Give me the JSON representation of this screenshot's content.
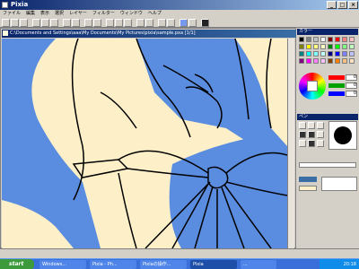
{
  "window": {
    "title": "Pixia",
    "minimize": "_",
    "maximize": "□",
    "close": "×"
  },
  "menu": [
    "ファイル",
    "編集",
    "表示",
    "選択",
    "レイヤー",
    "フィルター",
    "ウィンドウ",
    "ヘルプ"
  ],
  "document": {
    "title": "C:\\Documents and Settings\\aaa\\My Documents\\My Pictures\\pixia\\sample.pxa [1/1]"
  },
  "colors": {
    "canvas_bg": "#5a8de0",
    "skin": "#fdf0c8",
    "line": "#000000",
    "accent": "#0a246a"
  },
  "palette": {
    "title": "カラー",
    "swatches": [
      "#000000",
      "#808080",
      "#c0c0c0",
      "#ffffff",
      "#800000",
      "#ff0000",
      "#ff8080",
      "#ffc0c0",
      "#808000",
      "#ffff00",
      "#ffff80",
      "#ffffc0",
      "#008000",
      "#00ff00",
      "#80ff80",
      "#c0ffc0",
      "#008080",
      "#00ffff",
      "#80ffff",
      "#c0ffff",
      "#000080",
      "#0000ff",
      "#8080ff",
      "#c0c0ff",
      "#800080",
      "#ff00ff",
      "#ff80ff",
      "#ffc0ff",
      "#804000",
      "#ff8000",
      "#ffc080",
      "#ffe0c0"
    ],
    "rgb": [
      {
        "name": "R",
        "value": "0",
        "color": "#ff0000"
      },
      {
        "name": "G",
        "value": "0",
        "color": "#00a000"
      },
      {
        "name": "B",
        "value": "0",
        "color": "#0000ff"
      }
    ]
  },
  "tools": {
    "title": "ペン"
  },
  "taskbar": {
    "start": "start",
    "tasks": [
      "Windows...",
      "Pixia - Ph...",
      "Pixiaの操作...",
      "Pixia",
      "..."
    ],
    "clock": "20:18"
  }
}
